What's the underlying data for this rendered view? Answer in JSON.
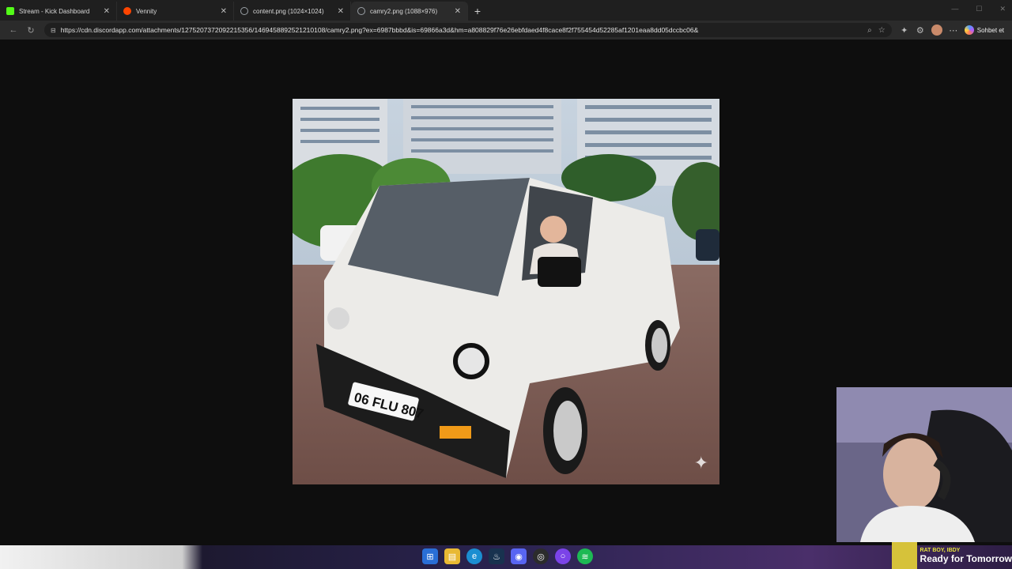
{
  "tabs": [
    {
      "title": "Stream - Kick Dashboard",
      "icon": "kick-icon",
      "color": "#53fc18",
      "active": false
    },
    {
      "title": "Vennity",
      "icon": "reddit-icon",
      "color": "#ff4500",
      "active": false
    },
    {
      "title": "content.png (1024×1024)",
      "icon": "globe-icon",
      "color": "#9aa0a6",
      "active": false
    },
    {
      "title": "camry2.png (1088×976)",
      "icon": "globe-icon",
      "color": "#9aa0a6",
      "active": true
    }
  ],
  "address_bar": {
    "url": "https://cdn.discordapp.com/attachments/1275207372092215356/1469458892521210108/camry2.png?ex=6987bbbd&is=69866a3d&hm=a808829f76e26ebfdaed4f8cace8f2f755454d52285af1201eaa8dd05dccbc06&"
  },
  "toolbar": {
    "copilot_label": "Sohbet et"
  },
  "image": {
    "name": "camry2.png",
    "plate": "06 FLU 807"
  },
  "now_playing": {
    "artist": "RAT BOY, IBDY",
    "title": "Ready for Tomorrow"
  },
  "colors": {
    "browser_bg": "#1f1f1f",
    "viewer_bg": "#0e0e0e",
    "accent_kick": "#53fc18"
  }
}
